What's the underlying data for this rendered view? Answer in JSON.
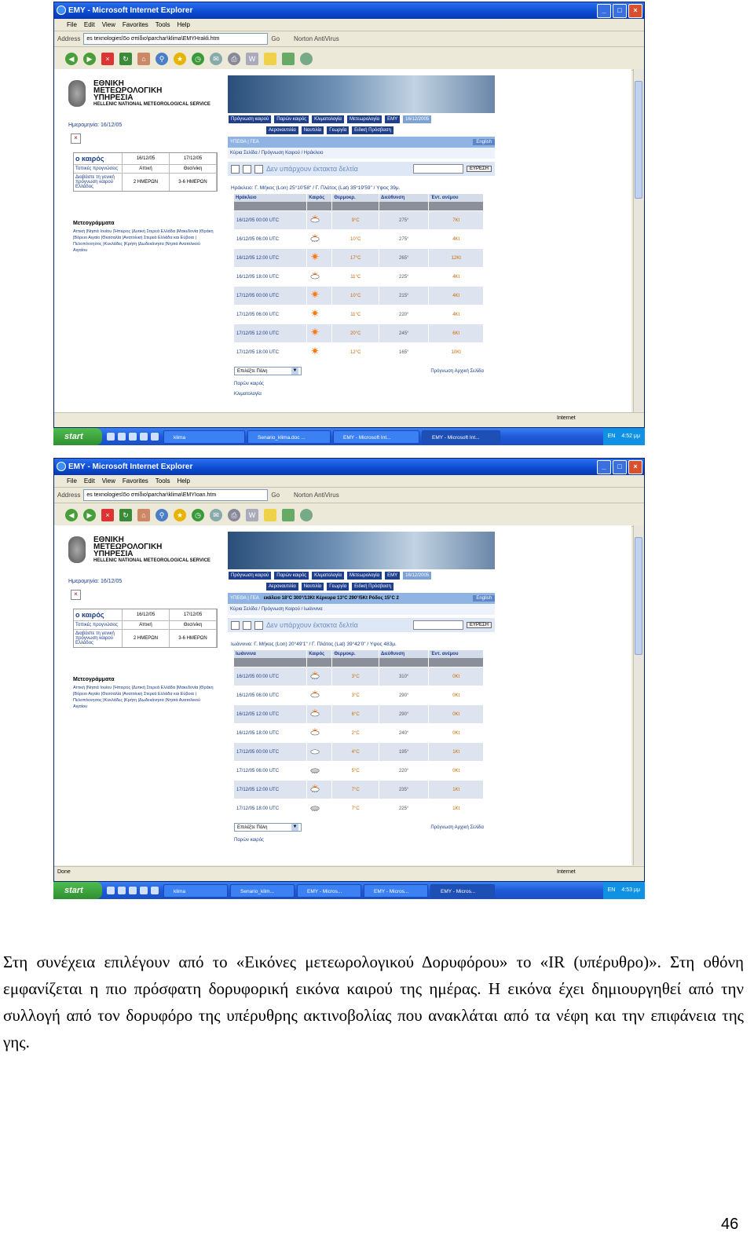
{
  "screenshots": [
    {
      "window_title": "ΕΜΥ - Microsoft Internet Explorer",
      "menu": [
        "File",
        "Edit",
        "View",
        "Favorites",
        "Tools",
        "Help"
      ],
      "address_label": "Address",
      "address_value": "es texnologies\\5o σπίδιο\\parchar\\klima\\EMYHrakli.htm",
      "go": "Go",
      "norton": "Norton AntiVirus",
      "site": {
        "logo_line1": "ΕΘΝΙΚΗ",
        "logo_line2": "ΜΕΤΕΩΡΟΛΟΓΙΚΗ",
        "logo_line3": "ΥΠΗΡΕΣΙΑ",
        "logo_line4": "HELLENIC NATIONAL METEOROLOGICAL SERVICE",
        "date_label": "Ημερομηνία: 16/12/05",
        "weather_head": "ο καιρός",
        "d1": "16/12/05",
        "d2": "17/12/05",
        "local_label": "Τοπικές προγνώσεις",
        "attiki": "Αττική",
        "thessaloniki": "Θεσ/νίκη",
        "general_label": "Διαβάστε τη γενική πρόγνωση καιρού Ελλάδος",
        "two_day": "2 ΗΜΕΡΩΝ",
        "three_six": "3-6 ΗΜΕΡΩΝ",
        "meteo_title": "Μετεογράμματα",
        "meteo_text": "Αττική |Νησιά Ιουίου |Ήπειρος |Δυτική Στερεά Ελλάδα |Μακεδονία |Θράκη |Βόρειο Αιγαίο |Θεσσαλία |Ανατολική Στερεά Ελλάδα και Εύβοια |Πελοπόννησος |Κυκλάδες |Κρήτη |Δωδεκάνησα |Νησιά Ανατολικού Αιγαίου",
        "nav_row1": [
          "Πρόγνωση καιρού",
          "Παρών καιρός",
          "Κλιματολογία",
          "Μετεωρολογία",
          "ΕΜΥ",
          "16/12/2005"
        ],
        "nav_row2": [
          "Αεροναυτιλία",
          "Ναυτιλία",
          "Γεωργία",
          "Ειδική Πρόσβαση"
        ],
        "blue_left": "ΥΠΕΘΑ | ΓΕΑ",
        "blue_mid": "",
        "english": "English",
        "crumb": "Κύρια Σελίδα / Πρόγνωση Καιρού / Ηράκλειο",
        "alert": "Δεν υπάρχουν έκτακτα δελτία",
        "search_btn": "ΕΥΡΕΣΗ",
        "coords": "Ηράκλειο: Γ. Μήκος (Lon) 25°10'58\" / Γ. Πλάτος (Lat) 35°19'59\" / Υψος 39μ.",
        "headers": [
          "Ηράκλειο",
          "Καιρός",
          "Θερμοκρ.",
          "Διεύθυνση",
          "Έντ. ανέμου"
        ],
        "rows": [
          {
            "time": "16/12/05 00:00 UTC",
            "icon": "partly-cloudy-night",
            "temp": "9°C",
            "dir": "275°",
            "wind": "7Kt"
          },
          {
            "time": "16/12/05 06:00 UTC",
            "icon": "rain-sun",
            "temp": "10°C",
            "dir": "275°",
            "wind": "4Kt"
          },
          {
            "time": "16/12/05 12:00 UTC",
            "icon": "sun",
            "temp": "17°C",
            "dir": "265°",
            "wind": "12Kt"
          },
          {
            "time": "16/12/05 18:00 UTC",
            "icon": "partly-cloudy-night",
            "temp": "11°C",
            "dir": "225°",
            "wind": "4Kt"
          },
          {
            "time": "17/12/05 00:00 UTC",
            "icon": "sun",
            "temp": "10°C",
            "dir": "215°",
            "wind": "4Kt"
          },
          {
            "time": "17/12/05 06:00 UTC",
            "icon": "sun",
            "temp": "11°C",
            "dir": "220°",
            "wind": "4Kt"
          },
          {
            "time": "17/12/05 12:00 UTC",
            "icon": "sun",
            "temp": "20°C",
            "dir": "245°",
            "wind": "6Kt"
          },
          {
            "time": "17/12/05 18:00 UTC",
            "icon": "sun",
            "temp": "12°C",
            "dir": "165°",
            "wind": "10Kt"
          }
        ],
        "select": "Επιλέξτε Πόλη",
        "prev": "Πρόγνωση Αρχική Σελίδα",
        "link1": "Παρών καιρός",
        "link2": "Κλιματολογία"
      },
      "status_left": "",
      "status_right": "Internet",
      "tasks": [
        "klima",
        "Senario_klima.doc ...",
        "ΕΜΥ - Microsoft Int...",
        "ΕΜΥ - Microsoft Int..."
      ],
      "start": "start",
      "lang": "EN",
      "clock": "4:52 μμ"
    },
    {
      "window_title": "ΕΜΥ - Microsoft Internet Explorer",
      "menu": [
        "File",
        "Edit",
        "View",
        "Favorites",
        "Tools",
        "Help"
      ],
      "address_label": "Address",
      "address_value": "es texnologies\\5o σπίδιο\\parchar\\klima\\EMYIoan.htm",
      "go": "Go",
      "norton": "Norton AntiVirus",
      "site": {
        "logo_line1": "ΕΘΝΙΚΗ",
        "logo_line2": "ΜΕΤΕΩΡΟΛΟΓΙΚΗ",
        "logo_line3": "ΥΠΗΡΕΣΙΑ",
        "logo_line4": "HELLENIC NATIONAL METEOROLOGICAL SERVICE",
        "date_label": "Ημερομηνία: 16/12/05",
        "weather_head": "ο καιρός",
        "d1": "16/12/05",
        "d2": "17/12/05",
        "local_label": "Τοπικές προγνώσεις",
        "attiki": "Αττική",
        "thessaloniki": "Θεσ/νίκη",
        "general_label": "Διαβάστε τη γενική πρόγνωση καιρού Ελλάδος",
        "two_day": "2 ΗΜΕΡΩΝ",
        "three_six": "3-6 ΗΜΕΡΩΝ",
        "meteo_title": "Μετεογράμματα",
        "meteo_text": "Αττική |Νησιά Ιουίου |Ήπειρος |Δυτική Στερεά Ελλάδα |Μακεδονία |Θράκη |Βόρειο Αιγαίο |Θεσσαλία |Ανατολική Στερεά Ελλάδα και Εύβοια |Πελοπόννησος |Κυκλάδες |Κρήτη |Δωδεκάνησα |Νησιά Ανατολικού Αιγαίου",
        "nav_row1": [
          "Πρόγνωση καιρού",
          "Παρών καιρός",
          "Κλιματολογία",
          "Μετεωρολογία",
          "ΕΜΥ",
          "16/12/2005"
        ],
        "nav_row2": [
          "Αεροναυτιλία",
          "Ναυτιλία",
          "Γεωργία",
          "Ειδική Πρόσβαση"
        ],
        "blue_left": "ΥΠΕΘΑ | ΓΕΑ",
        "blue_mid": "εκάλειο 18°C 300°/13Kt  Κέρκυρα 13°C 290°/5Kt  Ρόδος 15°C 2",
        "english": "English",
        "crumb": "Κύρια Σελίδα / Πρόγνωση Καιρού / Ιωάννινα",
        "alert": "Δεν υπάρχουν έκτακτα δελτία",
        "search_btn": "ΕΥΡΕΣΗ",
        "coords": "Ιωάννινα: Γ. Μήκος (Lon) 20°49'1\" / Γ. Πλάτος (Lat) 39°42'0\" / Υψος 483μ.",
        "headers": [
          "Ιωάννινα",
          "Καιρός",
          "Θερμοκρ.",
          "Διεύθυνση",
          "Έντ. ανέμου"
        ],
        "rows": [
          {
            "time": "16/12/05 00:00 UTC",
            "icon": "rain-night",
            "temp": "3°C",
            "dir": "310°",
            "wind": "0Kt"
          },
          {
            "time": "16/12/05 06:00 UTC",
            "icon": "cloud-sun",
            "temp": "3°C",
            "dir": "290°",
            "wind": "0Kt"
          },
          {
            "time": "16/12/05 12:00 UTC",
            "icon": "cloud-sun",
            "temp": "6°C",
            "dir": "290°",
            "wind": "0Kt"
          },
          {
            "time": "16/12/05 18:00 UTC",
            "icon": "partly-cloudy-night",
            "temp": "2°C",
            "dir": "240°",
            "wind": "0Kt"
          },
          {
            "time": "17/12/05 00:00 UTC",
            "icon": "cloud",
            "temp": "4°C",
            "dir": "195°",
            "wind": "1Kt"
          },
          {
            "time": "17/12/05 06:00 UTC",
            "icon": "rain",
            "temp": "5°C",
            "dir": "220°",
            "wind": "0Kt"
          },
          {
            "time": "17/12/05 12:00 UTC",
            "icon": "rain-sun",
            "temp": "7°C",
            "dir": "235°",
            "wind": "1Kt"
          },
          {
            "time": "17/12/05 18:00 UTC",
            "icon": "rain",
            "temp": "7°C",
            "dir": "225°",
            "wind": "1Kt"
          }
        ],
        "select": "Επιλέξτε Πόλη",
        "prev": "Πρόγνωση Αρχική Σελίδα",
        "link1": "Παρών καιρός",
        "link2": ""
      },
      "status_left": "Done",
      "status_right": "Internet",
      "tasks": [
        "klima",
        "Senario_klim...",
        "ΕΜΥ - Micros...",
        "ΕΜΥ - Micros...",
        "ΕΜΥ - Micros..."
      ],
      "start": "start",
      "lang": "EN",
      "clock": "4:53 μμ"
    }
  ],
  "paragraph": "Στη συνέχεια επιλέγουν  από το «Εικόνες μετεωρολογικού Δορυφόρου» το «IR (υπέρυθρο)». Στη οθόνη εμφανίζεται η πιο πρόσφατη δορυφορική εικόνα καιρού της ημέρας. Η εικόνα έχει δημιουργηθεί από την συλλογή από τον δορυφόρο της υπέρυθρης ακτινοβολίας που ανακλάται από τα νέφη και την επιφάνεια της γης.",
  "page_number": "46"
}
